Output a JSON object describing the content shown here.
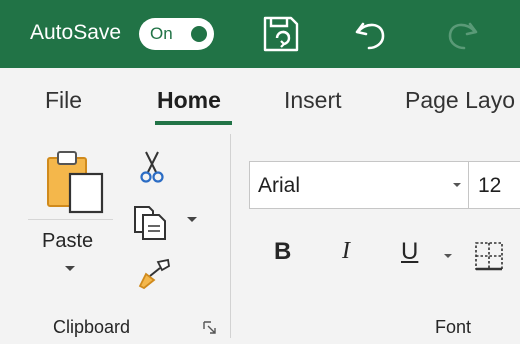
{
  "titlebar": {
    "autosave_label": "AutoSave",
    "autosave_state": "On",
    "icons": [
      "save-icon",
      "undo-icon",
      "redo-icon"
    ],
    "brand_color": "#217346"
  },
  "tabs": [
    {
      "label": "File",
      "active": false
    },
    {
      "label": "Home",
      "active": true
    },
    {
      "label": "Insert",
      "active": false
    },
    {
      "label": "Page Layo",
      "active": false
    }
  ],
  "clipboard": {
    "paste_label": "Paste",
    "group_label": "Clipboard",
    "icons": [
      "paste-icon",
      "cut-icon",
      "copy-icon",
      "format-painter-icon",
      "dialog-launcher-icon"
    ]
  },
  "font": {
    "font_name": "Arial",
    "font_size": "12",
    "bold_label": "B",
    "italic_label": "I",
    "underline_label": "U",
    "group_label": "Font"
  }
}
